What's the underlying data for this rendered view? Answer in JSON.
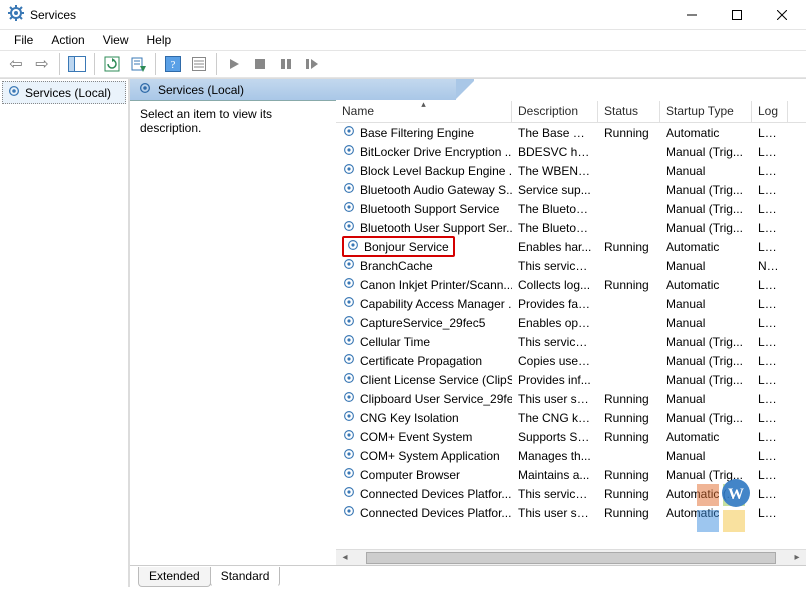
{
  "window": {
    "title": "Services"
  },
  "menu": {
    "file": "File",
    "action": "Action",
    "view": "View",
    "help": "Help"
  },
  "tree": {
    "root": "Services (Local)"
  },
  "header": {
    "title": "Services (Local)"
  },
  "desc": {
    "prompt": "Select an item to view its description."
  },
  "columns": {
    "name": "Name",
    "description": "Description",
    "status": "Status",
    "startup": "Startup Type",
    "logon": "Log"
  },
  "tabs": {
    "extended": "Extended",
    "standard": "Standard"
  },
  "services": [
    {
      "name": "Base Filtering Engine",
      "desc": "The Base Fil...",
      "status": "Running",
      "startup": "Automatic",
      "logon": "Loca"
    },
    {
      "name": "BitLocker Drive Encryption ...",
      "desc": "BDESVC hos...",
      "status": "",
      "startup": "Manual (Trig...",
      "logon": "Loca"
    },
    {
      "name": "Block Level Backup Engine ...",
      "desc": "The WBENG...",
      "status": "",
      "startup": "Manual",
      "logon": "Loca"
    },
    {
      "name": "Bluetooth Audio Gateway S...",
      "desc": "Service sup...",
      "status": "",
      "startup": "Manual (Trig...",
      "logon": "Loca"
    },
    {
      "name": "Bluetooth Support Service",
      "desc": "The Bluetoo...",
      "status": "",
      "startup": "Manual (Trig...",
      "logon": "Loca"
    },
    {
      "name": "Bluetooth User Support Ser...",
      "desc": "The Bluetoo...",
      "status": "",
      "startup": "Manual (Trig...",
      "logon": "Loca"
    },
    {
      "name": "Bonjour Service",
      "desc": "Enables har...",
      "status": "Running",
      "startup": "Automatic",
      "logon": "Loca",
      "hl": true
    },
    {
      "name": "BranchCache",
      "desc": "This service ...",
      "status": "",
      "startup": "Manual",
      "logon": "Netv"
    },
    {
      "name": "Canon Inkjet Printer/Scann...",
      "desc": "Collects log...",
      "status": "Running",
      "startup": "Automatic",
      "logon": "Loca"
    },
    {
      "name": "Capability Access Manager ...",
      "desc": "Provides fac...",
      "status": "",
      "startup": "Manual",
      "logon": "Loca"
    },
    {
      "name": "CaptureService_29fec5",
      "desc": "Enables opti...",
      "status": "",
      "startup": "Manual",
      "logon": "Loca"
    },
    {
      "name": "Cellular Time",
      "desc": "This service ...",
      "status": "",
      "startup": "Manual (Trig...",
      "logon": "Loca"
    },
    {
      "name": "Certificate Propagation",
      "desc": "Copies user ...",
      "status": "",
      "startup": "Manual (Trig...",
      "logon": "Loca"
    },
    {
      "name": "Client License Service (ClipS...",
      "desc": "Provides inf...",
      "status": "",
      "startup": "Manual (Trig...",
      "logon": "Loca"
    },
    {
      "name": "Clipboard User Service_29fe...",
      "desc": "This user ser...",
      "status": "Running",
      "startup": "Manual",
      "logon": "Loca"
    },
    {
      "name": "CNG Key Isolation",
      "desc": "The CNG ke...",
      "status": "Running",
      "startup": "Manual (Trig...",
      "logon": "Loca"
    },
    {
      "name": "COM+ Event System",
      "desc": "Supports Sy...",
      "status": "Running",
      "startup": "Automatic",
      "logon": "Loca"
    },
    {
      "name": "COM+ System Application",
      "desc": "Manages th...",
      "status": "",
      "startup": "Manual",
      "logon": "Loca"
    },
    {
      "name": "Computer Browser",
      "desc": "Maintains a...",
      "status": "Running",
      "startup": "Manual (Trig...",
      "logon": "Loca"
    },
    {
      "name": "Connected Devices Platfor...",
      "desc": "This service ...",
      "status": "Running",
      "startup": "Automatic (...",
      "logon": "Loca"
    },
    {
      "name": "Connected Devices Platfor...",
      "desc": "This user ser...",
      "status": "Running",
      "startup": "Automatic",
      "logon": "Loca"
    }
  ]
}
